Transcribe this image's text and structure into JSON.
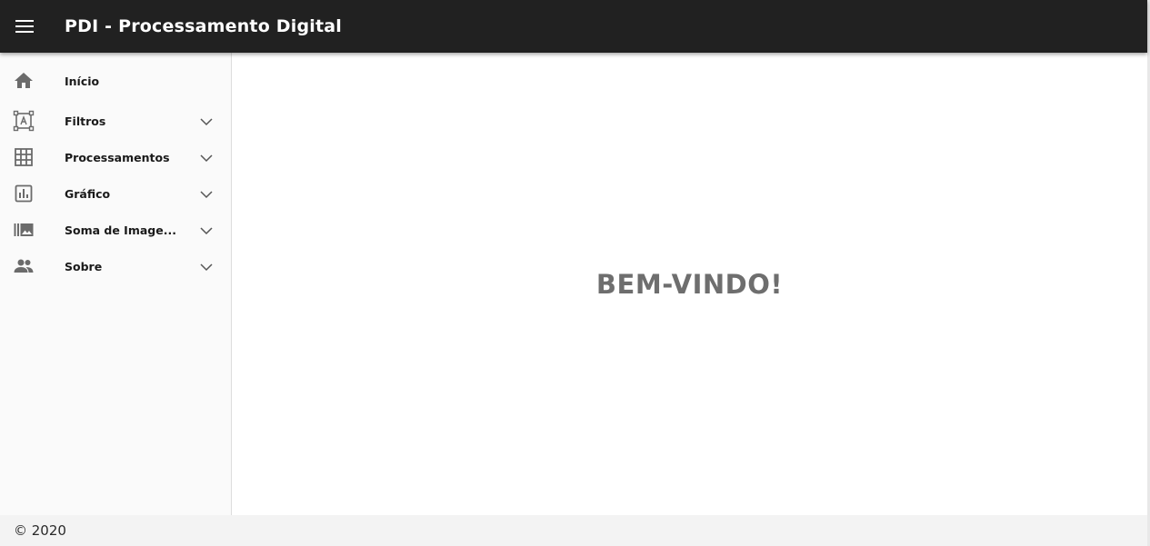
{
  "header": {
    "title": "PDI - Processamento Digital",
    "menu_icon": "menu-icon",
    "background": "#212121"
  },
  "sidebar": {
    "items": [
      {
        "label": "Início",
        "icon": "home-icon",
        "expandable": false
      },
      {
        "label": "Filtros",
        "icon": "text-frame-icon",
        "expandable": true
      },
      {
        "label": "Processamentos",
        "icon": "grid-icon",
        "expandable": true
      },
      {
        "label": "Gráfico",
        "icon": "bar-chart-icon",
        "expandable": true
      },
      {
        "label": "Soma de Image...",
        "icon": "image-library-icon",
        "expandable": true
      },
      {
        "label": "Sobre",
        "icon": "people-icon",
        "expandable": true
      }
    ]
  },
  "main": {
    "welcome_text": "BEM-VINDO!",
    "welcome_color": "#6e6e6e"
  },
  "footer": {
    "copyright": "© 2020"
  }
}
